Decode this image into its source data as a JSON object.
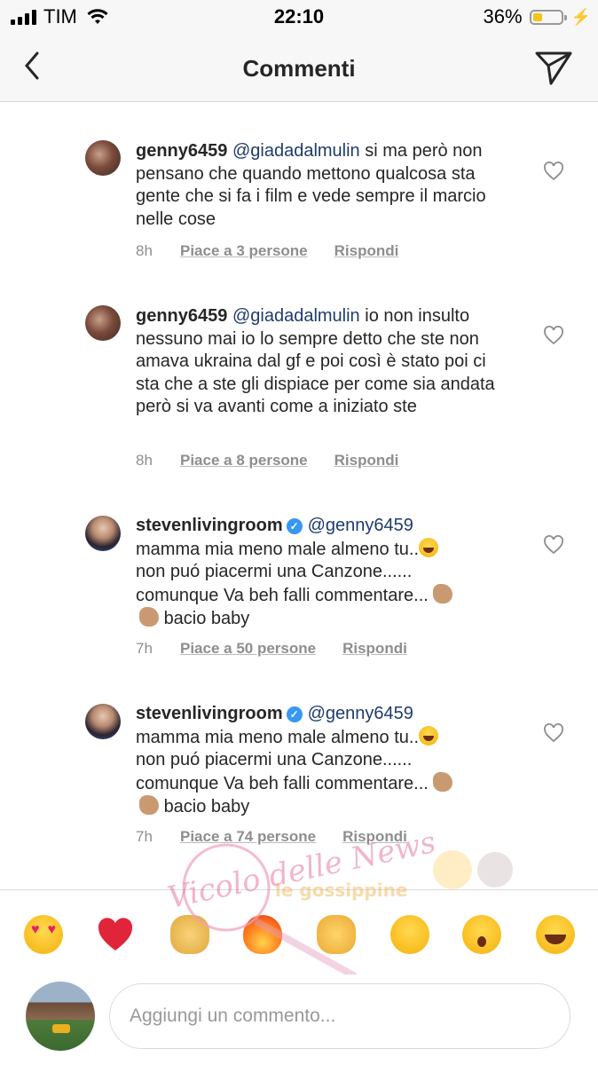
{
  "status_bar": {
    "carrier": "TIM",
    "time": "22:10",
    "battery_percent": "36%",
    "battery_level": 0.36,
    "battery_color": "#f6c41a"
  },
  "nav": {
    "title": "Commenti",
    "back_icon": "chevron-left-icon",
    "send_icon": "paper-plane-icon"
  },
  "comments": [
    {
      "username": "genny6459",
      "verified": false,
      "mention": "@giadadalmulin",
      "text": "si ma però non pensano che quando mettono qualcosa sta gente che si fa i film e vede sempre il marcio nelle cose",
      "time": "8h",
      "likes": "Piace a 3 persone",
      "reply": "Rispondi"
    },
    {
      "username": "genny6459",
      "verified": false,
      "mention": "@giadadalmulin",
      "text": "io non insulto nessuno mai io lo sempre detto che ste non amava ukraina dal gf e poi così è stato poi ci sta che a ste gli dispiace per come sia andata però si va avanti come a iniziato ste",
      "time": "8h",
      "likes": "Piace a 8 persone",
      "reply": "Rispondi"
    },
    {
      "username": "stevenlivingroom",
      "verified": true,
      "mention": "@genny6459",
      "line1": "mamma mia meno male almeno tu..",
      "line2": "non puó piacermi una Canzone......",
      "line3": "comunque Va beh falli commentare...",
      "line4": "bacio baby",
      "time": "7h",
      "likes": "Piace a 50 persone",
      "reply": "Rispondi"
    },
    {
      "username": "stevenlivingroom",
      "verified": true,
      "mention": "@genny6459",
      "line1": "mamma mia meno male almeno tu..",
      "line2": "non puó piacermi una Canzone......",
      "line3": "comunque Va beh falli commentare...",
      "line4": "bacio baby",
      "time": "7h",
      "likes": "Piace a 74 persone",
      "reply": "Rispondi"
    }
  ],
  "emoji_bar": [
    "heart-eyes",
    "red-heart",
    "raised-hands",
    "fire",
    "clapping-hands",
    "crying-face",
    "surprised-face",
    "tears-of-joy"
  ],
  "watermark": {
    "text1": "Vicolo delle News",
    "text2": "le gossippine"
  },
  "composer": {
    "placeholder": "Aggiungi un commento..."
  }
}
